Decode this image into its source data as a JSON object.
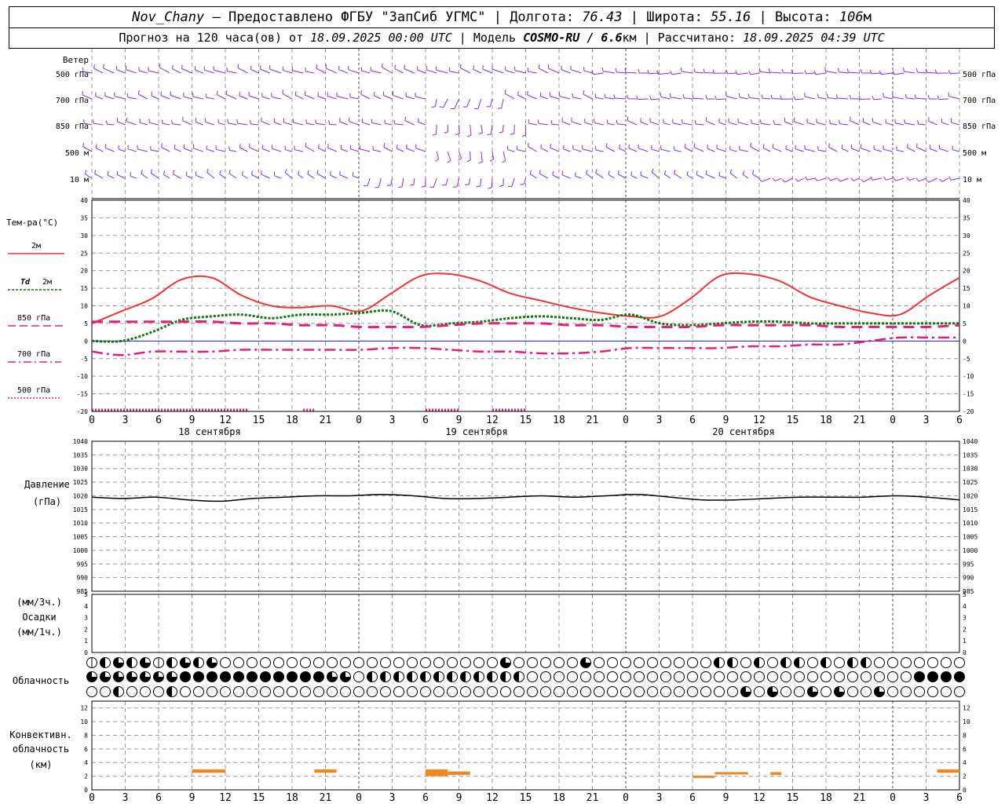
{
  "header": {
    "station": "Nov_Chany",
    "provider": " — Предоставлено ФГБУ \"ЗапСиб УГМС\" | Долгота: ",
    "lon": "76.43",
    "lat_label": " | Широта: ",
    "lat": "55.16",
    "alt_label": " | Высота: ",
    "alt": "106",
    "alt_unit": "м",
    "fc_label": "Прогноз на 120 часа(ов) от ",
    "fc_time": "18.09.2025 00:00 UTC",
    "model_label": "  | Модель ",
    "model": "COSMO-RU / 6.6",
    "model_unit": "км",
    "calc_label": " | Рассчитано: ",
    "calc_time": "18.09.2025 04:39 UTC"
  },
  "labels": {
    "wind_title": "Ветер",
    "wind_levels": [
      "500 гПа",
      "700 гПа",
      "850 гПа",
      "500 м",
      "10  м"
    ],
    "temp_title": "Тем-ра(°С)",
    "temp_2m": "2м",
    "td_sym": "Td",
    "td_2m": "2м",
    "t850": "850 гПа",
    "t700": "700 гПа",
    "t500": "500 гПа",
    "pressure_title": "Давление",
    "pressure_unit": "(гПа)",
    "precip_unit_top": "(мм/3ч.)",
    "precip_title": "Осадки",
    "precip_unit_bottom": "(мм/1ч.)",
    "cloud_title": "Облачность",
    "conv_title": [
      "Конвективн.",
      "облачность",
      "(км)"
    ],
    "days": [
      "18 сентября",
      "19 сентября",
      "20 сентября"
    ],
    "hour_ticks": [
      "0",
      "3",
      "6",
      "9",
      "12",
      "15",
      "18",
      "21",
      "0",
      "3",
      "6",
      "9",
      "12",
      "15",
      "18",
      "21",
      "0",
      "3",
      "6",
      "9",
      "12",
      "15",
      "18",
      "21",
      "0",
      "3",
      "6"
    ]
  },
  "colors": {
    "wind": "#8a2be2",
    "t2m": "#ee3333",
    "td2m": "#117711",
    "t850": "#e0207a",
    "t700": "#e0207a",
    "t500": "#e0207a",
    "pressure": "#000000",
    "conv": "#ee8822",
    "zero_line": "#2222cc",
    "grid": "#999999"
  },
  "chart_data": [
    {
      "type": "line",
      "panel": "temperature",
      "ylim": [
        -20,
        40
      ],
      "yticks": [
        -20,
        -15,
        -10,
        -5,
        0,
        5,
        10,
        15,
        20,
        25,
        30,
        35,
        40
      ],
      "x_hours": [
        0,
        3,
        6,
        9,
        12,
        15,
        18,
        21,
        24,
        27,
        30,
        33,
        36,
        39,
        42,
        45,
        48,
        51,
        54,
        57,
        60,
        63,
        66,
        69,
        72,
        75,
        78
      ],
      "series": [
        {
          "key": "t2m",
          "values": [
            5,
            8.5,
            12,
            17.5,
            18,
            13,
            10,
            9.5,
            10,
            8.5,
            13.5,
            18.5,
            19,
            17,
            13.5,
            11.5,
            9.5,
            8,
            7,
            7,
            12,
            18.5,
            19,
            17,
            12.5,
            10,
            8,
            7.5,
            13,
            18
          ]
        },
        {
          "key": "td2m",
          "values": [
            0,
            0,
            2.5,
            6,
            7,
            7.5,
            6.5,
            7.5,
            7.5,
            8,
            8.5,
            4.5,
            5,
            5.5,
            6.5,
            7,
            6.5,
            6,
            7.5,
            5,
            4.5,
            5,
            5.5,
            5.5,
            5,
            5,
            5,
            5,
            5,
            5
          ]
        },
        {
          "key": "t850",
          "values": [
            5.5,
            5.5,
            5.5,
            5.5,
            5.5,
            5,
            5,
            4.5,
            4.5,
            4,
            4,
            4,
            4.5,
            5,
            5,
            5,
            4.5,
            4.5,
            4,
            4,
            4,
            4.5,
            4.5,
            4.5,
            4.5,
            4,
            4,
            4,
            4,
            4.5
          ]
        },
        {
          "key": "t700",
          "values": [
            -3,
            -4,
            -3,
            -3,
            -3,
            -2.5,
            -2.5,
            -2.5,
            -2.5,
            -2.5,
            -2,
            -2,
            -2.5,
            -3,
            -3,
            -3.5,
            -3.5,
            -3,
            -2,
            -2,
            -2,
            -2,
            -1.5,
            -1.5,
            -1,
            -1,
            0,
            1,
            1,
            1
          ]
        }
      ]
    },
    {
      "type": "line",
      "panel": "pressure",
      "ylim": [
        985,
        1040
      ],
      "yticks": [
        985,
        990,
        995,
        1000,
        1005,
        1010,
        1015,
        1020,
        1025,
        1030,
        1035,
        1040
      ],
      "series": [
        {
          "key": "pressure",
          "values": [
            1019.5,
            1019,
            1019.5,
            1018.5,
            1018,
            1019,
            1019.5,
            1020,
            1020,
            1020.5,
            1020,
            1019,
            1019,
            1019.5,
            1020,
            1019.5,
            1020,
            1020.5,
            1019.5,
            1018.5,
            1018.5,
            1019,
            1019.5,
            1019.5,
            1019.5,
            1020,
            1019.5,
            1018.5
          ]
        }
      ]
    },
    {
      "type": "bar",
      "panel": "precipitation",
      "ylim": [
        0,
        5
      ],
      "yticks": [
        0,
        1,
        2,
        3,
        4,
        5
      ],
      "values": []
    },
    {
      "type": "bar",
      "panel": "convective_cloud",
      "ylim": [
        0,
        13
      ],
      "yticks": [
        0,
        2,
        4,
        6,
        8,
        10,
        12
      ],
      "segments": [
        {
          "h_start": 9,
          "h_end": 12,
          "base": 2.5,
          "top": 3
        },
        {
          "h_start": 20,
          "h_end": 22,
          "base": 2.5,
          "top": 3
        },
        {
          "h_start": 30,
          "h_end": 32,
          "base": 2,
          "top": 3
        },
        {
          "h_start": 32,
          "h_end": 34,
          "base": 2.2,
          "top": 2.7
        },
        {
          "h_start": 54,
          "h_end": 56,
          "base": 1.8,
          "top": 2.1
        },
        {
          "h_start": 56,
          "h_end": 59,
          "base": 2.3,
          "top": 2.6
        },
        {
          "h_start": 61,
          "h_end": 62,
          "base": 2.2,
          "top": 2.6
        },
        {
          "h_start": 76,
          "h_end": 78,
          "base": 2.5,
          "top": 3
        }
      ]
    }
  ]
}
